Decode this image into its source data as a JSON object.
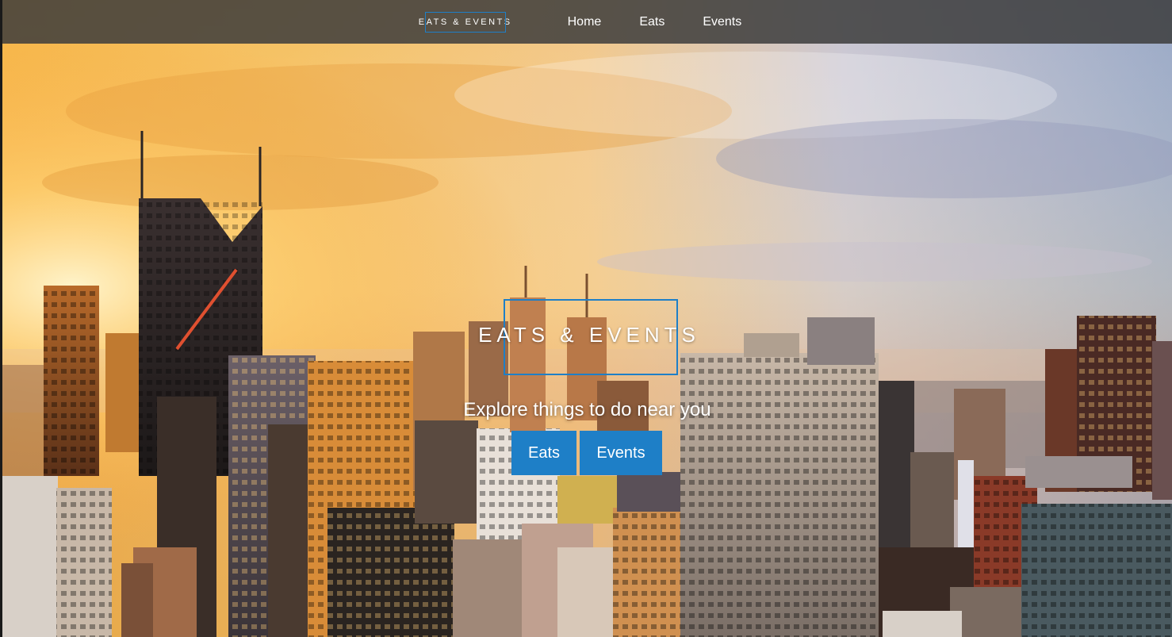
{
  "navbar": {
    "logo": "EATS & EVENTS",
    "links": [
      {
        "label": "Home"
      },
      {
        "label": "Eats"
      },
      {
        "label": "Events"
      }
    ]
  },
  "hero": {
    "logo": "EATS & EVENTS",
    "tagline": "Explore things to do near you",
    "buttons": [
      {
        "label": "Eats"
      },
      {
        "label": "Events"
      }
    ],
    "background_description_icon": "city-skyline-image"
  },
  "colors": {
    "accent": "#1e7fc7",
    "navbar_bg": "#3c3c3c",
    "text": "#ffffff"
  }
}
